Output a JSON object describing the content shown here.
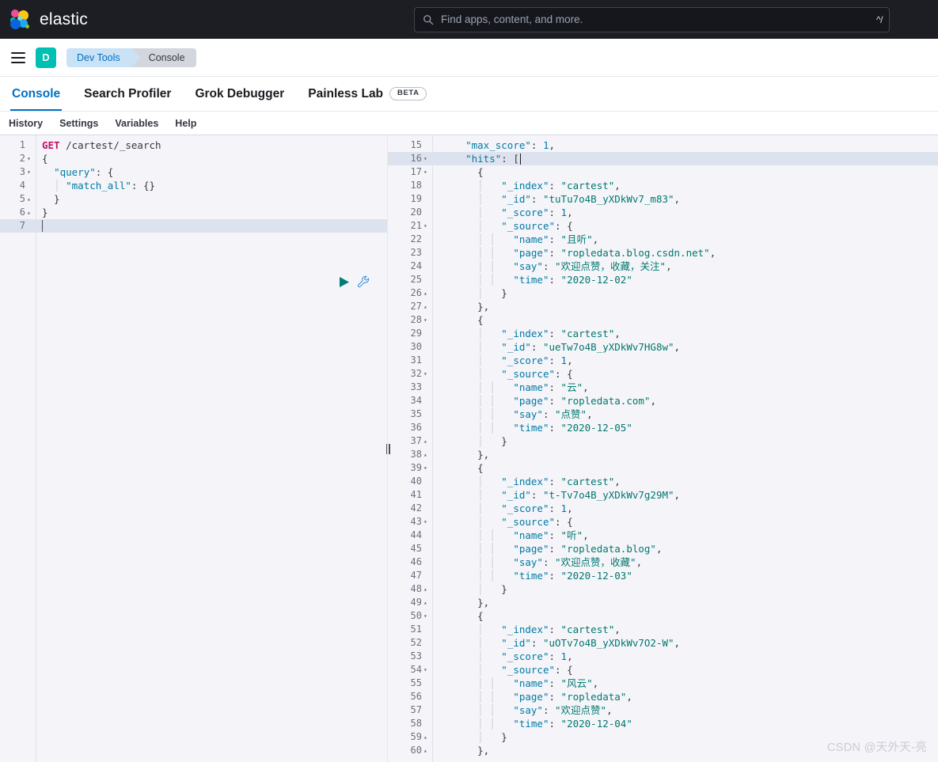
{
  "topbar": {
    "brand": "elastic",
    "logo_icon": "elastic-logo",
    "search": {
      "icon": "search-icon",
      "placeholder": "Find apps, content, and more.",
      "value": "",
      "shortcut": "^/"
    }
  },
  "breadcrumb_bar": {
    "menu_icon": "hamburger-menu-icon",
    "space_avatar": "D",
    "crumbs": [
      {
        "label": "Dev Tools",
        "color": "#0071c2",
        "bg": "#c9e2f5"
      },
      {
        "label": "Console",
        "color": "#343741",
        "bg": "#d3d7dd"
      }
    ]
  },
  "app_tabs": {
    "items": [
      {
        "label": "Console",
        "active": true
      },
      {
        "label": "Search Profiler",
        "active": false
      },
      {
        "label": "Grok Debugger",
        "active": false
      },
      {
        "label": "Painless Lab",
        "active": false,
        "badge": "BETA"
      }
    ]
  },
  "sub_menu": {
    "items": [
      "History",
      "Settings",
      "Variables",
      "Help"
    ]
  },
  "editor": {
    "actions": {
      "run_icon": "play-triangle-icon",
      "wrench_icon": "wrench-icon"
    },
    "active_line": 7,
    "lines": [
      {
        "num": 1,
        "fold": "",
        "tokens": [
          {
            "t": "GET",
            "c": "m"
          },
          {
            "t": " ",
            "c": "p"
          },
          {
            "t": "/cartest/_search",
            "c": "u"
          }
        ]
      },
      {
        "num": 2,
        "fold": "▾",
        "tokens": [
          {
            "t": "{",
            "c": "p"
          }
        ]
      },
      {
        "num": 3,
        "fold": "▾",
        "tokens": [
          {
            "t": "  ",
            "c": "p"
          },
          {
            "t": "\"query\"",
            "c": "k"
          },
          {
            "t": ": {",
            "c": "p"
          }
        ]
      },
      {
        "num": 4,
        "fold": "",
        "tokens": [
          {
            "t": "  ",
            "c": "p"
          },
          {
            "t": "│",
            "c": "ind"
          },
          {
            "t": " ",
            "c": "p"
          },
          {
            "t": "\"match_all\"",
            "c": "k"
          },
          {
            "t": ": {}",
            "c": "p"
          }
        ]
      },
      {
        "num": 5,
        "fold": "▴",
        "tokens": [
          {
            "t": "  }",
            "c": "p"
          }
        ]
      },
      {
        "num": 6,
        "fold": "▴",
        "tokens": [
          {
            "t": "}",
            "c": "p"
          }
        ]
      },
      {
        "num": 7,
        "fold": "",
        "tokens": []
      }
    ]
  },
  "response": {
    "active_line": 16,
    "lines": [
      {
        "num": 15,
        "fold": "",
        "tokens": [
          {
            "t": "    ",
            "c": "p"
          },
          {
            "t": "\"max_score\"",
            "c": "k"
          },
          {
            "t": ": ",
            "c": "p"
          },
          {
            "t": "1",
            "c": "n"
          },
          {
            "t": ",",
            "c": "p"
          }
        ]
      },
      {
        "num": 16,
        "fold": "▾",
        "tokens": [
          {
            "t": "    ",
            "c": "p"
          },
          {
            "t": "\"hits\"",
            "c": "k"
          },
          {
            "t": ": [",
            "c": "p"
          }
        ],
        "cursor": true
      },
      {
        "num": 17,
        "fold": "▾",
        "tokens": [
          {
            "t": "      {",
            "c": "p"
          }
        ]
      },
      {
        "num": 18,
        "fold": "",
        "tokens": [
          {
            "t": "      │ ",
            "c": "ind"
          },
          {
            "t": "  \"_index\"",
            "c": "k"
          },
          {
            "t": ": ",
            "c": "p"
          },
          {
            "t": "\"cartest\"",
            "c": "s"
          },
          {
            "t": ",",
            "c": "p"
          }
        ]
      },
      {
        "num": 19,
        "fold": "",
        "tokens": [
          {
            "t": "      │ ",
            "c": "ind"
          },
          {
            "t": "  \"_id\"",
            "c": "k"
          },
          {
            "t": ": ",
            "c": "p"
          },
          {
            "t": "\"tuTu7o4B_yXDkWv7_m83\"",
            "c": "s"
          },
          {
            "t": ",",
            "c": "p"
          }
        ]
      },
      {
        "num": 20,
        "fold": "",
        "tokens": [
          {
            "t": "      │ ",
            "c": "ind"
          },
          {
            "t": "  \"_score\"",
            "c": "k"
          },
          {
            "t": ": ",
            "c": "p"
          },
          {
            "t": "1",
            "c": "n"
          },
          {
            "t": ",",
            "c": "p"
          }
        ]
      },
      {
        "num": 21,
        "fold": "▾",
        "tokens": [
          {
            "t": "      │ ",
            "c": "ind"
          },
          {
            "t": "  \"_source\"",
            "c": "k"
          },
          {
            "t": ": {",
            "c": "p"
          }
        ]
      },
      {
        "num": 22,
        "fold": "",
        "tokens": [
          {
            "t": "      │ │ ",
            "c": "ind"
          },
          {
            "t": "  \"name\"",
            "c": "k"
          },
          {
            "t": ": ",
            "c": "p"
          },
          {
            "t": "\"且听\"",
            "c": "s"
          },
          {
            "t": ",",
            "c": "p"
          }
        ]
      },
      {
        "num": 23,
        "fold": "",
        "tokens": [
          {
            "t": "      │ │ ",
            "c": "ind"
          },
          {
            "t": "  \"page\"",
            "c": "k"
          },
          {
            "t": ": ",
            "c": "p"
          },
          {
            "t": "\"ropledata.blog.csdn.net\"",
            "c": "s"
          },
          {
            "t": ",",
            "c": "p"
          }
        ]
      },
      {
        "num": 24,
        "fold": "",
        "tokens": [
          {
            "t": "      │ │ ",
            "c": "ind"
          },
          {
            "t": "  \"say\"",
            "c": "k"
          },
          {
            "t": ": ",
            "c": "p"
          },
          {
            "t": "\"欢迎点赞，收藏，关注\"",
            "c": "s"
          },
          {
            "t": ",",
            "c": "p"
          }
        ]
      },
      {
        "num": 25,
        "fold": "",
        "tokens": [
          {
            "t": "      │ │ ",
            "c": "ind"
          },
          {
            "t": "  \"time\"",
            "c": "k"
          },
          {
            "t": ": ",
            "c": "p"
          },
          {
            "t": "\"2020-12-02\"",
            "c": "s"
          }
        ]
      },
      {
        "num": 26,
        "fold": "▴",
        "tokens": [
          {
            "t": "      │ ",
            "c": "ind"
          },
          {
            "t": "  }",
            "c": "p"
          }
        ]
      },
      {
        "num": 27,
        "fold": "▴",
        "tokens": [
          {
            "t": "      },",
            "c": "p"
          }
        ]
      },
      {
        "num": 28,
        "fold": "▾",
        "tokens": [
          {
            "t": "      {",
            "c": "p"
          }
        ]
      },
      {
        "num": 29,
        "fold": "",
        "tokens": [
          {
            "t": "      │ ",
            "c": "ind"
          },
          {
            "t": "  \"_index\"",
            "c": "k"
          },
          {
            "t": ": ",
            "c": "p"
          },
          {
            "t": "\"cartest\"",
            "c": "s"
          },
          {
            "t": ",",
            "c": "p"
          }
        ]
      },
      {
        "num": 30,
        "fold": "",
        "tokens": [
          {
            "t": "      │ ",
            "c": "ind"
          },
          {
            "t": "  \"_id\"",
            "c": "k"
          },
          {
            "t": ": ",
            "c": "p"
          },
          {
            "t": "\"ueTw7o4B_yXDkWv7HG8w\"",
            "c": "s"
          },
          {
            "t": ",",
            "c": "p"
          }
        ]
      },
      {
        "num": 31,
        "fold": "",
        "tokens": [
          {
            "t": "      │ ",
            "c": "ind"
          },
          {
            "t": "  \"_score\"",
            "c": "k"
          },
          {
            "t": ": ",
            "c": "p"
          },
          {
            "t": "1",
            "c": "n"
          },
          {
            "t": ",",
            "c": "p"
          }
        ]
      },
      {
        "num": 32,
        "fold": "▾",
        "tokens": [
          {
            "t": "      │ ",
            "c": "ind"
          },
          {
            "t": "  \"_source\"",
            "c": "k"
          },
          {
            "t": ": {",
            "c": "p"
          }
        ]
      },
      {
        "num": 33,
        "fold": "",
        "tokens": [
          {
            "t": "      │ │ ",
            "c": "ind"
          },
          {
            "t": "  \"name\"",
            "c": "k"
          },
          {
            "t": ": ",
            "c": "p"
          },
          {
            "t": "\"云\"",
            "c": "s"
          },
          {
            "t": ",",
            "c": "p"
          }
        ]
      },
      {
        "num": 34,
        "fold": "",
        "tokens": [
          {
            "t": "      │ │ ",
            "c": "ind"
          },
          {
            "t": "  \"page\"",
            "c": "k"
          },
          {
            "t": ": ",
            "c": "p"
          },
          {
            "t": "\"ropledata.com\"",
            "c": "s"
          },
          {
            "t": ",",
            "c": "p"
          }
        ]
      },
      {
        "num": 35,
        "fold": "",
        "tokens": [
          {
            "t": "      │ │ ",
            "c": "ind"
          },
          {
            "t": "  \"say\"",
            "c": "k"
          },
          {
            "t": ": ",
            "c": "p"
          },
          {
            "t": "\"点赞\"",
            "c": "s"
          },
          {
            "t": ",",
            "c": "p"
          }
        ]
      },
      {
        "num": 36,
        "fold": "",
        "tokens": [
          {
            "t": "      │ │ ",
            "c": "ind"
          },
          {
            "t": "  \"time\"",
            "c": "k"
          },
          {
            "t": ": ",
            "c": "p"
          },
          {
            "t": "\"2020-12-05\"",
            "c": "s"
          }
        ]
      },
      {
        "num": 37,
        "fold": "▴",
        "tokens": [
          {
            "t": "      │ ",
            "c": "ind"
          },
          {
            "t": "  }",
            "c": "p"
          }
        ]
      },
      {
        "num": 38,
        "fold": "▴",
        "tokens": [
          {
            "t": "      },",
            "c": "p"
          }
        ]
      },
      {
        "num": 39,
        "fold": "▾",
        "tokens": [
          {
            "t": "      {",
            "c": "p"
          }
        ]
      },
      {
        "num": 40,
        "fold": "",
        "tokens": [
          {
            "t": "      │ ",
            "c": "ind"
          },
          {
            "t": "  \"_index\"",
            "c": "k"
          },
          {
            "t": ": ",
            "c": "p"
          },
          {
            "t": "\"cartest\"",
            "c": "s"
          },
          {
            "t": ",",
            "c": "p"
          }
        ]
      },
      {
        "num": 41,
        "fold": "",
        "tokens": [
          {
            "t": "      │ ",
            "c": "ind"
          },
          {
            "t": "  \"_id\"",
            "c": "k"
          },
          {
            "t": ": ",
            "c": "p"
          },
          {
            "t": "\"t-Tv7o4B_yXDkWv7g29M\"",
            "c": "s"
          },
          {
            "t": ",",
            "c": "p"
          }
        ]
      },
      {
        "num": 42,
        "fold": "",
        "tokens": [
          {
            "t": "      │ ",
            "c": "ind"
          },
          {
            "t": "  \"_score\"",
            "c": "k"
          },
          {
            "t": ": ",
            "c": "p"
          },
          {
            "t": "1",
            "c": "n"
          },
          {
            "t": ",",
            "c": "p"
          }
        ]
      },
      {
        "num": 43,
        "fold": "▾",
        "tokens": [
          {
            "t": "      │ ",
            "c": "ind"
          },
          {
            "t": "  \"_source\"",
            "c": "k"
          },
          {
            "t": ": {",
            "c": "p"
          }
        ]
      },
      {
        "num": 44,
        "fold": "",
        "tokens": [
          {
            "t": "      │ │ ",
            "c": "ind"
          },
          {
            "t": "  \"name\"",
            "c": "k"
          },
          {
            "t": ": ",
            "c": "p"
          },
          {
            "t": "\"听\"",
            "c": "s"
          },
          {
            "t": ",",
            "c": "p"
          }
        ]
      },
      {
        "num": 45,
        "fold": "",
        "tokens": [
          {
            "t": "      │ │ ",
            "c": "ind"
          },
          {
            "t": "  \"page\"",
            "c": "k"
          },
          {
            "t": ": ",
            "c": "p"
          },
          {
            "t": "\"ropledata.blog\"",
            "c": "s"
          },
          {
            "t": ",",
            "c": "p"
          }
        ]
      },
      {
        "num": 46,
        "fold": "",
        "tokens": [
          {
            "t": "      │ │ ",
            "c": "ind"
          },
          {
            "t": "  \"say\"",
            "c": "k"
          },
          {
            "t": ": ",
            "c": "p"
          },
          {
            "t": "\"欢迎点赞，收藏\"",
            "c": "s"
          },
          {
            "t": ",",
            "c": "p"
          }
        ]
      },
      {
        "num": 47,
        "fold": "",
        "tokens": [
          {
            "t": "      │ │ ",
            "c": "ind"
          },
          {
            "t": "  \"time\"",
            "c": "k"
          },
          {
            "t": ": ",
            "c": "p"
          },
          {
            "t": "\"2020-12-03\"",
            "c": "s"
          }
        ]
      },
      {
        "num": 48,
        "fold": "▴",
        "tokens": [
          {
            "t": "      │ ",
            "c": "ind"
          },
          {
            "t": "  }",
            "c": "p"
          }
        ]
      },
      {
        "num": 49,
        "fold": "▴",
        "tokens": [
          {
            "t": "      },",
            "c": "p"
          }
        ]
      },
      {
        "num": 50,
        "fold": "▾",
        "tokens": [
          {
            "t": "      {",
            "c": "p"
          }
        ]
      },
      {
        "num": 51,
        "fold": "",
        "tokens": [
          {
            "t": "      │ ",
            "c": "ind"
          },
          {
            "t": "  \"_index\"",
            "c": "k"
          },
          {
            "t": ": ",
            "c": "p"
          },
          {
            "t": "\"cartest\"",
            "c": "s"
          },
          {
            "t": ",",
            "c": "p"
          }
        ]
      },
      {
        "num": 52,
        "fold": "",
        "tokens": [
          {
            "t": "      │ ",
            "c": "ind"
          },
          {
            "t": "  \"_id\"",
            "c": "k"
          },
          {
            "t": ": ",
            "c": "p"
          },
          {
            "t": "\"uOTv7o4B_yXDkWv7O2-W\"",
            "c": "s"
          },
          {
            "t": ",",
            "c": "p"
          }
        ]
      },
      {
        "num": 53,
        "fold": "",
        "tokens": [
          {
            "t": "      │ ",
            "c": "ind"
          },
          {
            "t": "  \"_score\"",
            "c": "k"
          },
          {
            "t": ": ",
            "c": "p"
          },
          {
            "t": "1",
            "c": "n"
          },
          {
            "t": ",",
            "c": "p"
          }
        ]
      },
      {
        "num": 54,
        "fold": "▾",
        "tokens": [
          {
            "t": "      │ ",
            "c": "ind"
          },
          {
            "t": "  \"_source\"",
            "c": "k"
          },
          {
            "t": ": {",
            "c": "p"
          }
        ]
      },
      {
        "num": 55,
        "fold": "",
        "tokens": [
          {
            "t": "      │ │ ",
            "c": "ind"
          },
          {
            "t": "  \"name\"",
            "c": "k"
          },
          {
            "t": ": ",
            "c": "p"
          },
          {
            "t": "\"风云\"",
            "c": "s"
          },
          {
            "t": ",",
            "c": "p"
          }
        ]
      },
      {
        "num": 56,
        "fold": "",
        "tokens": [
          {
            "t": "      │ │ ",
            "c": "ind"
          },
          {
            "t": "  \"page\"",
            "c": "k"
          },
          {
            "t": ": ",
            "c": "p"
          },
          {
            "t": "\"ropledata\"",
            "c": "s"
          },
          {
            "t": ",",
            "c": "p"
          }
        ]
      },
      {
        "num": 57,
        "fold": "",
        "tokens": [
          {
            "t": "      │ │ ",
            "c": "ind"
          },
          {
            "t": "  \"say\"",
            "c": "k"
          },
          {
            "t": ": ",
            "c": "p"
          },
          {
            "t": "\"欢迎点赞\"",
            "c": "s"
          },
          {
            "t": ",",
            "c": "p"
          }
        ]
      },
      {
        "num": 58,
        "fold": "",
        "tokens": [
          {
            "t": "      │ │ ",
            "c": "ind"
          },
          {
            "t": "  \"time\"",
            "c": "k"
          },
          {
            "t": ": ",
            "c": "p"
          },
          {
            "t": "\"2020-12-04\"",
            "c": "s"
          }
        ]
      },
      {
        "num": 59,
        "fold": "▴",
        "tokens": [
          {
            "t": "      │ ",
            "c": "ind"
          },
          {
            "t": "  }",
            "c": "p"
          }
        ]
      },
      {
        "num": 60,
        "fold": "▴",
        "tokens": [
          {
            "t": "      },",
            "c": "p"
          }
        ]
      }
    ]
  },
  "splitter": {
    "name": "pane-splitter"
  },
  "watermark": "CSDN @天外天-亮"
}
